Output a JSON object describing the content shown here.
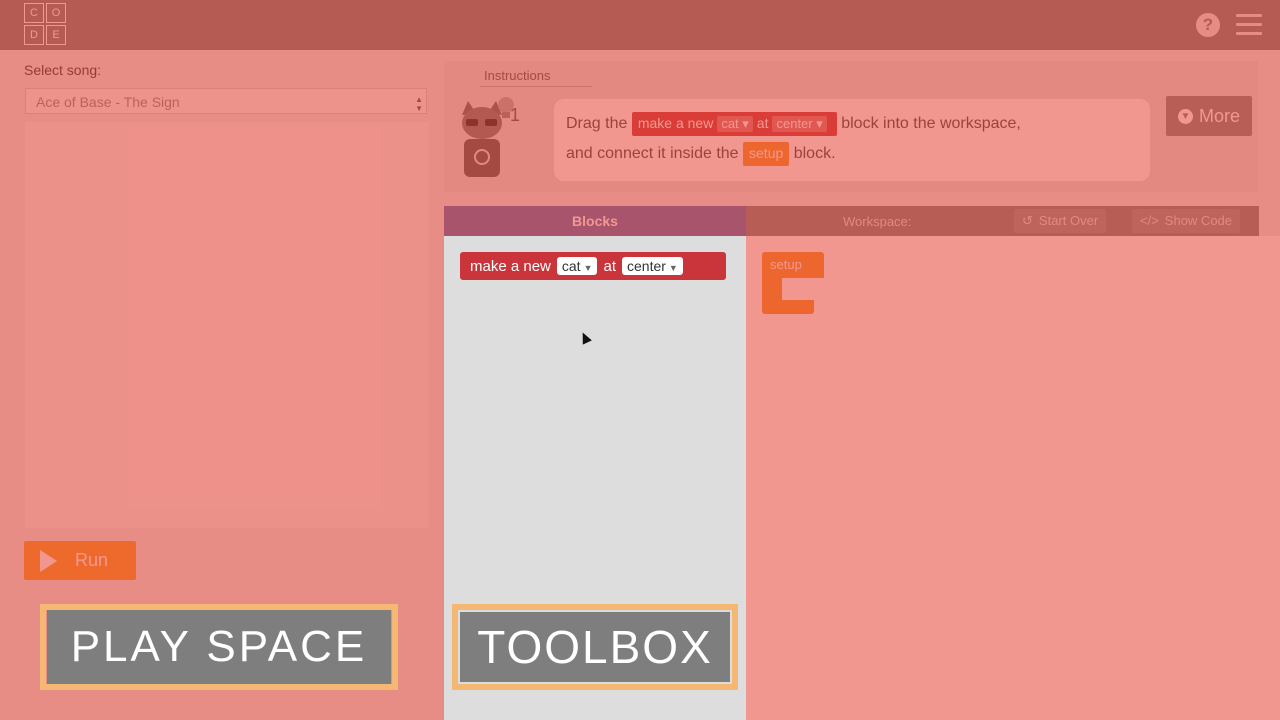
{
  "logo": {
    "letters": [
      "C",
      "O",
      "D",
      "E"
    ]
  },
  "header": {
    "help_icon": "question-circle-icon",
    "menu_icon": "hamburger-menu-icon"
  },
  "song": {
    "label": "Select song:",
    "value": "Ace of Base - The Sign"
  },
  "run": {
    "label": "Run",
    "icon": "play-icon"
  },
  "overlay_labels": {
    "play_space": "PLAY SPACE",
    "toolbox": "TOOLBOX"
  },
  "instructions": {
    "tab_label": "Instructions",
    "hint_count": "1",
    "text_part1": "Drag the",
    "text_part2": "block into the workspace,",
    "text_part3": "and connect it inside the",
    "text_part4": "block.",
    "inline_make": {
      "label": "make a new",
      "field1": "cat",
      "at": "at",
      "field2": "center"
    },
    "inline_setup": "setup",
    "more_label": "More"
  },
  "blocks_panel": {
    "title": "Blocks"
  },
  "workspace_panel": {
    "title": "Workspace:",
    "start_over": "Start Over",
    "show_code": "Show Code"
  },
  "toolbox_block": {
    "label": "make a new",
    "field1": "cat",
    "at": "at",
    "field2": "center"
  },
  "workspace_block": {
    "label": "setup"
  },
  "colors": {
    "overlay": "#e84234",
    "blocks_header": "#5a6ab0",
    "block_red": "#c9353b",
    "block_orange": "#f29324",
    "run_orange": "#f59b22"
  }
}
